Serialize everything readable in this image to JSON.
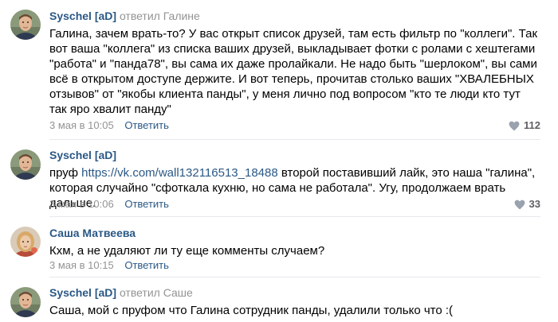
{
  "comments": [
    {
      "author": "Syschel [aD]",
      "replied_prefix": "ответил",
      "replied_to": "Галине",
      "text": "Галина, зачем врать-то? У вас открыт список друзей, там есть фильтр по \"коллеги\". Так вот ваша \"коллега\" из списка ваших друзей, выкладывает фотки с ролами с хештегами \"работа\" и \"панда78\", вы сама их даже пролайкали. Не надо быть \"шерлоком\", вы сами всё в открытом доступе держите. И вот теперь, прочитав столько ваших \"ХВАЛЕБНЫХ отзывов\" от \"якобы клиента панды\", у меня лично под вопросом \"кто те люди кто тут так яро хвалит панду\"",
      "date": "3 мая в 10:05",
      "reply_label": "Ответить",
      "likes": "112"
    },
    {
      "author": "Syschel [aD]",
      "text_before": "пруф ",
      "link": "https://vk.com/wall132116513_18488",
      "text_after": " второй поставивший лайк, это наша \"галина\", которая случайно \"сфоткала кухню, но сама не работала\". Угу, продолжаем врать дальше.",
      "date": "3 мая в 10:06",
      "reply_label": "Ответить",
      "likes": "33"
    },
    {
      "author": "Саша Матвеева",
      "text": "Кхм, а не удаляют ли ту еще комменты случаем?",
      "date": "3 мая в 10:15",
      "reply_label": "Ответить"
    },
    {
      "author": "Syschel [aD]",
      "replied_prefix": "ответил",
      "replied_to": "Саше",
      "text": "Саша, мой с пруфом что Галина сотрудник панды, удалили только что :("
    }
  ],
  "colors": {
    "link": "#2a5885",
    "muted": "#939393",
    "divider": "#e7e8ec"
  },
  "icons": {
    "like": "heart-icon"
  }
}
